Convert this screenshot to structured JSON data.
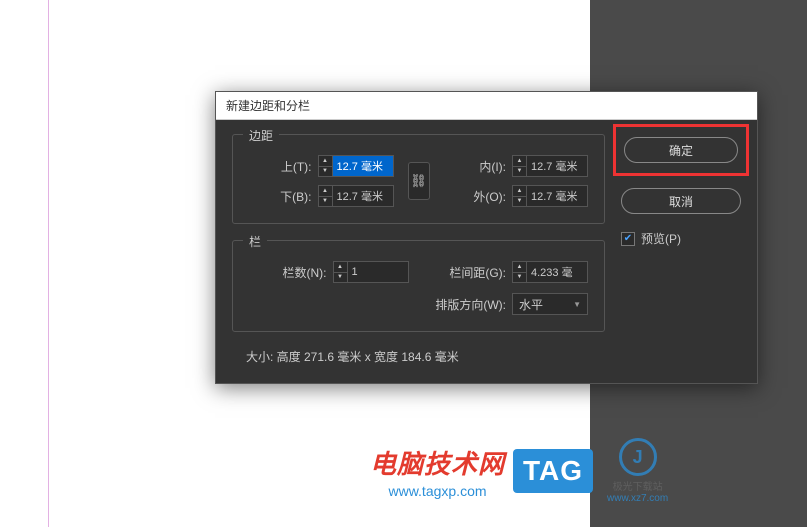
{
  "dialog": {
    "title": "新建边距和分栏",
    "margins": {
      "legend": "边距",
      "top_label": "上(T):",
      "top_value": "12.7 毫米",
      "bottom_label": "下(B):",
      "bottom_value": "12.7 毫米",
      "inner_label": "内(I):",
      "inner_value": "12.7 毫米",
      "outer_label": "外(O):",
      "outer_value": "12.7 毫米"
    },
    "columns": {
      "legend": "栏",
      "count_label": "栏数(N):",
      "count_value": "1",
      "gutter_label": "栏间距(G):",
      "gutter_value": "4.233 毫",
      "direction_label": "排版方向(W):",
      "direction_value": "水平"
    },
    "size_text": "大小: 高度 271.6 毫米 x 宽度 184.6 毫米",
    "buttons": {
      "ok": "确定",
      "cancel": "取消"
    },
    "preview": {
      "label": "预览(P)",
      "checked": true
    }
  },
  "watermark": {
    "site_cn": "电脑技术网",
    "site_url": "www.tagxp.com",
    "tag": "TAG",
    "jg_name": "极光下载站",
    "jg_url": "www.xz7.com"
  }
}
